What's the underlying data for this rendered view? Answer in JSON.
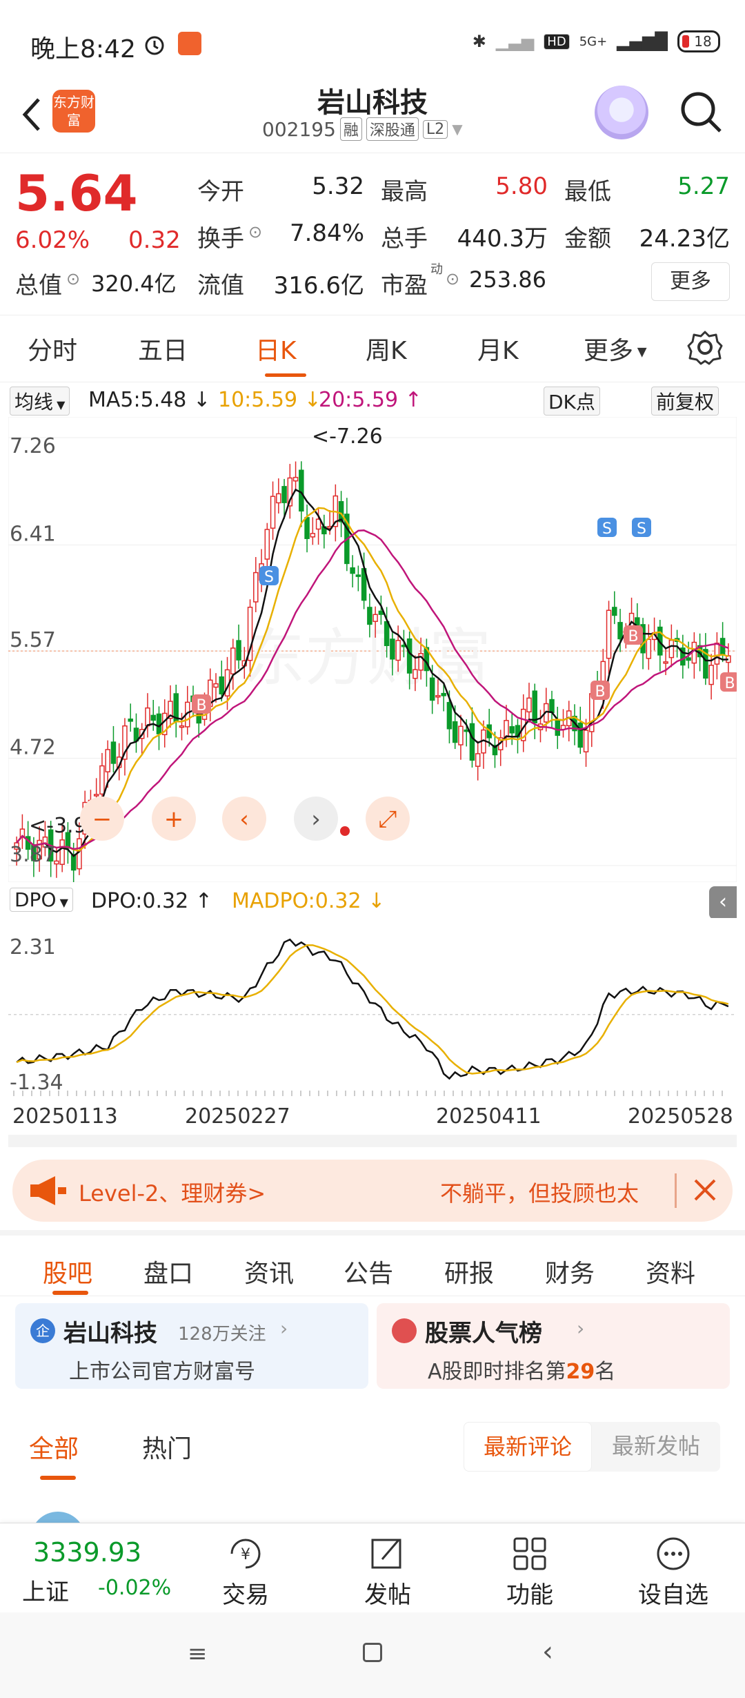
{
  "status_bar": {
    "time": "晚上8:42",
    "network": "5G+",
    "hd": "HD",
    "battery": "18"
  },
  "header": {
    "logo_text": "东方财富",
    "stock_name": "岩山科技",
    "stock_code": "002195",
    "tags": [
      "融",
      "深股通",
      "L2"
    ]
  },
  "quote": {
    "price": "5.64",
    "change_pct": "6.02%",
    "change_val": "0.32",
    "open_label": "今开",
    "open": "5.32",
    "high_label": "最高",
    "high": "5.80",
    "low_label": "最低",
    "low": "5.27",
    "turnover_label": "换手",
    "turnover": "7.84%",
    "volume_label": "总手",
    "volume": "440.3万",
    "amount_label": "金额",
    "amount": "24.23亿",
    "mcap_label": "总值",
    "mcap": "320.4亿",
    "float_label": "流值",
    "float": "316.6亿",
    "pe_label": "市盈",
    "pe_sup": "动",
    "pe": "253.86",
    "more": "更多"
  },
  "period_tabs": [
    "分时",
    "五日",
    "日K",
    "周K",
    "月K",
    "更多"
  ],
  "active_period": "日K",
  "ma_legend": {
    "selector": "均线",
    "ma5": "MA5:5.48",
    "ma10": "10:5.59",
    "ma20": "20:5.59",
    "dk_button": "DK点",
    "adjust_button": "前复权"
  },
  "kchart": {
    "y_labels": [
      "7.26",
      "6.41",
      "5.57",
      "4.72",
      "3.87"
    ],
    "max_label": "<-7.26",
    "min_label": "<-3.90",
    "watermark": "东方财富",
    "ref_price": 5.57
  },
  "dpo": {
    "selector": "DPO",
    "dpo_val": "DPO:0.32",
    "madpo_val": "MADPO:0.32",
    "y_labels": [
      "2.31",
      "-1.34"
    ]
  },
  "dates": [
    "20250113",
    "20250227",
    "20250411",
    "20250528"
  ],
  "banner": {
    "left": "Level-2、理财券>",
    "right": "不躺平，但投顾也太"
  },
  "content_tabs": [
    "股吧",
    "盘口",
    "资讯",
    "公告",
    "研报",
    "财务",
    "资料"
  ],
  "cards": {
    "c1_title": "岩山科技",
    "c1_follow": "128万关注",
    "c1_sub": "上市公司官方财富号",
    "c2_title": "股票人气榜",
    "c2_sub_pre": "A股即时排名第",
    "c2_rank": "29",
    "c2_sub_post": "名"
  },
  "sub_tabs": [
    "全部",
    "热门"
  ],
  "sort_tabs": [
    "最新评论",
    "最新发帖"
  ],
  "bottom_nav": {
    "index_val": "3339.93",
    "index_name": "上证",
    "index_chg": "-0.02%",
    "items": [
      "交易",
      "发帖",
      "功能",
      "设自选"
    ]
  },
  "colors": {
    "up": "#e02a2a",
    "down": "#0a9a2a",
    "ma5": "#111111",
    "ma10": "#e8b000",
    "ma20": "#c0157a",
    "accent": "#e8560d"
  }
}
